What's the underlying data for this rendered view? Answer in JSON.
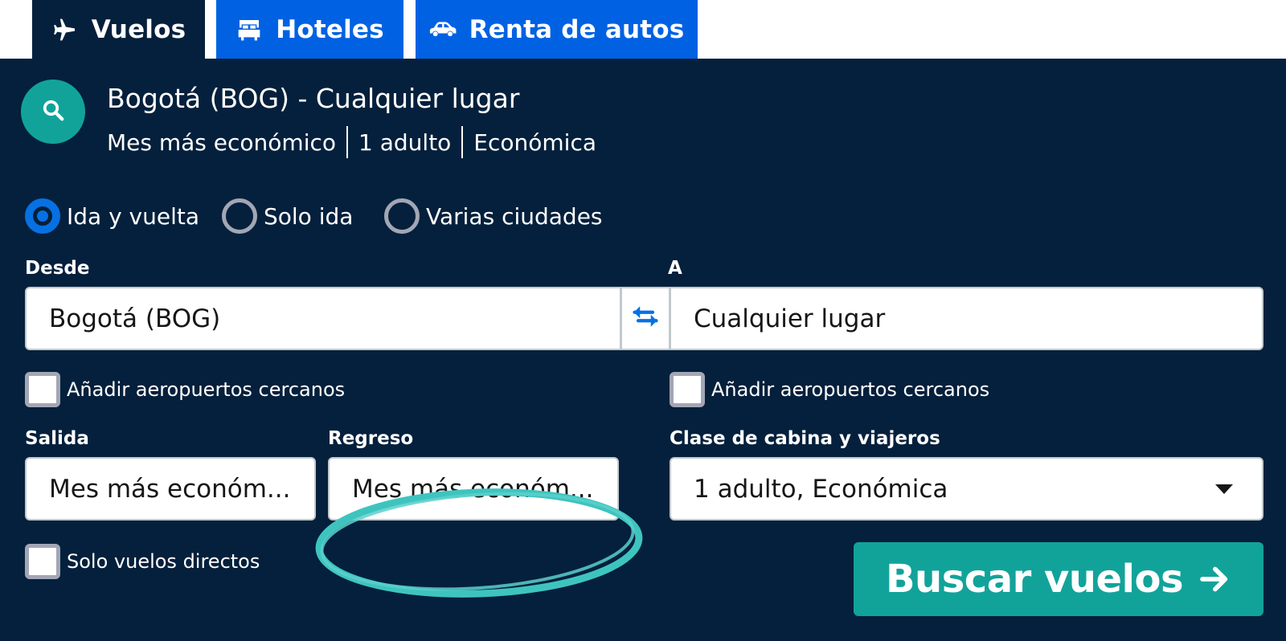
{
  "tabs": [
    {
      "label": "Vuelos",
      "icon": "airplane-icon",
      "active": true
    },
    {
      "label": "Hoteles",
      "icon": "bed-icon",
      "active": false
    },
    {
      "label": "Renta de autos",
      "icon": "car-icon",
      "active": false
    }
  ],
  "summary": {
    "icon": "search-icon",
    "route": "Bogotá (BOG) - Cualquier lugar",
    "when": "Mes más económico",
    "travelers": "1 adulto",
    "cabin": "Económica"
  },
  "trip_types": [
    {
      "label": "Ida y vuelta",
      "selected": true
    },
    {
      "label": "Solo ida",
      "selected": false
    },
    {
      "label": "Varias ciudades",
      "selected": false
    }
  ],
  "from": {
    "label": "Desde",
    "value": "Bogotá (BOG)",
    "nearby_label": "Añadir aeropuertos cercanos",
    "nearby_checked": false
  },
  "swap_icon": "swap-arrows-icon",
  "to": {
    "label": "A",
    "value": "Cualquier lugar",
    "nearby_label": "Añadir aeropuertos cercanos",
    "nearby_checked": false
  },
  "depart": {
    "label": "Salida",
    "value": "Mes más económ..."
  },
  "return": {
    "label": "Regreso",
    "value": "Mes más económ...",
    "annotation": "circled"
  },
  "cabin_travelers": {
    "label": "Clase de cabina y viajeros",
    "value": "1 adulto, Económica",
    "icon": "caret-down-icon"
  },
  "direct_only": {
    "label": "Solo vuelos directos",
    "checked": false
  },
  "search_button": {
    "label": "Buscar vuelos",
    "icon": "arrow-right-icon"
  },
  "colors": {
    "navy": "#05203c",
    "blue": "#0062e3",
    "teal": "#11a39a",
    "annotation": "#3ec4bf"
  }
}
